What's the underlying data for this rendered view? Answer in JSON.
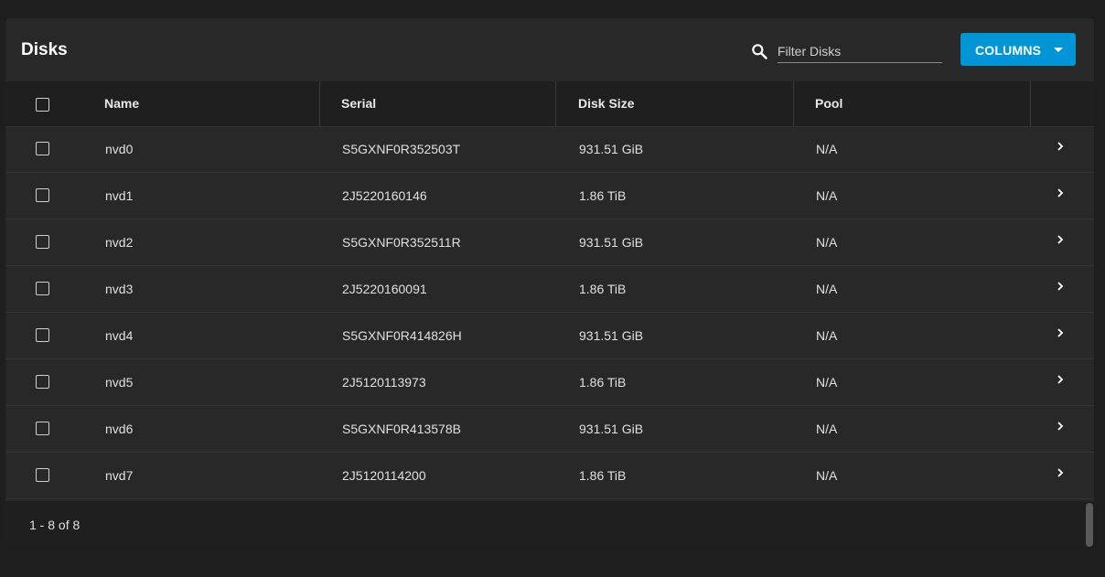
{
  "header": {
    "title": "Disks",
    "filter_placeholder": "Filter Disks",
    "columns_label": "COLUMNS"
  },
  "table": {
    "columns": [
      "Name",
      "Serial",
      "Disk Size",
      "Pool"
    ],
    "rows": [
      {
        "name": "nvd0",
        "serial": "S5GXNF0R352503T",
        "size": "931.51 GiB",
        "pool": "N/A"
      },
      {
        "name": "nvd1",
        "serial": "2J5220160146",
        "size": "1.86 TiB",
        "pool": "N/A"
      },
      {
        "name": "nvd2",
        "serial": "S5GXNF0R352511R",
        "size": "931.51 GiB",
        "pool": "N/A"
      },
      {
        "name": "nvd3",
        "serial": "2J5220160091",
        "size": "1.86 TiB",
        "pool": "N/A"
      },
      {
        "name": "nvd4",
        "serial": "S5GXNF0R414826H",
        "size": "931.51 GiB",
        "pool": "N/A"
      },
      {
        "name": "nvd5",
        "serial": "2J5120113973",
        "size": "1.86 TiB",
        "pool": "N/A"
      },
      {
        "name": "nvd6",
        "serial": "S5GXNF0R413578B",
        "size": "931.51 GiB",
        "pool": "N/A"
      },
      {
        "name": "nvd7",
        "serial": "2J5120114200",
        "size": "1.86 TiB",
        "pool": "N/A"
      }
    ]
  },
  "footer": {
    "range_label": "1 - 8 of 8"
  },
  "colors": {
    "accent": "#0095d5",
    "background": "#1e1e1e",
    "card": "#282828"
  },
  "icons": {
    "search": "search-icon",
    "row_action": "chevron-right-icon"
  }
}
